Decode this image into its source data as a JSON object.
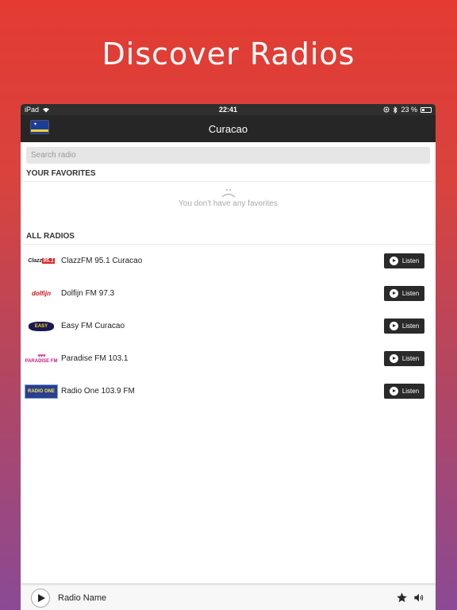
{
  "headline": "Discover Radios",
  "statusbar": {
    "device": "iPad",
    "time": "22:41",
    "battery": "23 %"
  },
  "navbar": {
    "title": "Curacao",
    "flag_icon": "curacao-flag-icon"
  },
  "search": {
    "placeholder": "Search radio"
  },
  "favorites": {
    "header": "YOUR FAVORITES",
    "empty_text": "You don't have any favorites"
  },
  "all_radios": {
    "header": "ALL RADIOS",
    "items": [
      {
        "name": "ClazzFM 95.1 Curacao",
        "logo_text": "Clazz",
        "logo_tag": "95.1",
        "listen_label": "Listen"
      },
      {
        "name": "Dolfijn FM 97.3",
        "logo_text": "dolfijn",
        "listen_label": "Listen"
      },
      {
        "name": "Easy FM Curacao",
        "logo_text": "EASY",
        "listen_label": "Listen"
      },
      {
        "name": "Paradise FM 103.1",
        "logo_text": "PARADISE FM",
        "listen_label": "Listen"
      },
      {
        "name": "Radio One 103.9 FM",
        "logo_text": "RADIO ONE",
        "listen_label": "Listen"
      }
    ]
  },
  "player": {
    "name": "Radio Name",
    "icons": [
      "star-icon",
      "speaker-icon"
    ]
  },
  "colors": {
    "accent_top": "#e33b32",
    "accent_bottom": "#8a4a94",
    "navbar": "#262626",
    "listen_button": "#2a2a2a"
  }
}
